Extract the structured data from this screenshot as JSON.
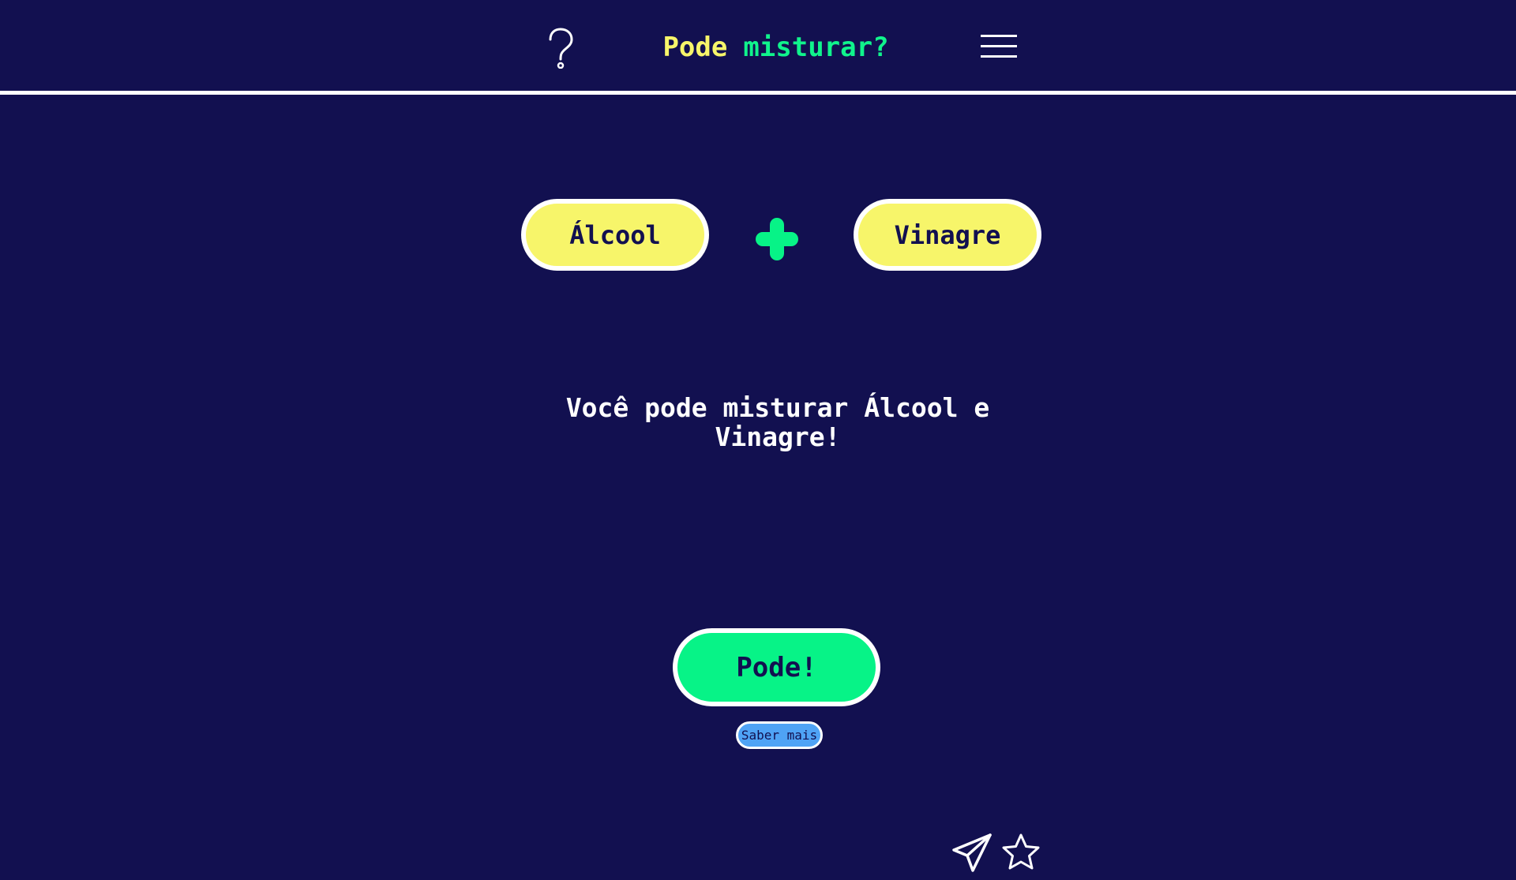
{
  "header": {
    "title_part1": "Pode",
    "title_part2": "misturar?",
    "help_icon": "question-mark-icon",
    "menu_icon": "hamburger-menu-icon"
  },
  "mix": {
    "ingredient_1": "Álcool",
    "ingredient_2": "Vinagre",
    "operator_icon": "plus-icon"
  },
  "result": {
    "message": "Você pode misturar Álcool e Vinagre!"
  },
  "answer": {
    "label": "Pode!",
    "learn_more_label": "Saber mais"
  },
  "footer": {
    "share_icon": "paper-plane-icon",
    "favorite_icon": "star-icon"
  },
  "colors": {
    "background": "#121050",
    "yellow": "#f7f56a",
    "green": "#07f387",
    "blue": "#4fa3f5",
    "white": "#ffffff"
  }
}
